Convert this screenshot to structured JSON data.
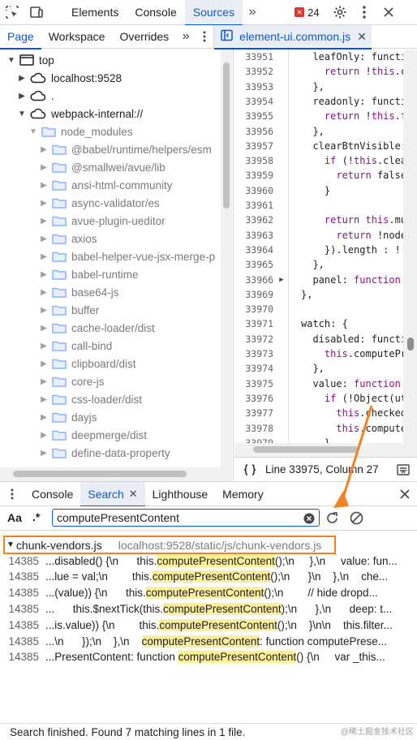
{
  "main_toolbar": {
    "tabs": [
      "Elements",
      "Console",
      "Sources"
    ],
    "active_tab": "Sources",
    "error_count": "24"
  },
  "sources_toolbar": {
    "tabs": [
      "Page",
      "Workspace",
      "Overrides"
    ],
    "active_tab": "Page",
    "open_file": "element-ui.common.js"
  },
  "navigator": {
    "items": [
      {
        "label": "top",
        "kind": "frame",
        "expanded": true
      },
      {
        "label": "localhost:9528",
        "kind": "cloud",
        "expanded": false
      },
      {
        "label": ".",
        "kind": "cloud",
        "expanded": false
      },
      {
        "label": "webpack-internal://",
        "kind": "cloud",
        "expanded": true
      },
      {
        "label": "node_modules",
        "kind": "folder",
        "expanded": true
      },
      {
        "label": "@babel/runtime/helpers/esm",
        "kind": "folder",
        "expanded": false
      },
      {
        "label": "@smallwei/avue/lib",
        "kind": "folder",
        "expanded": false
      },
      {
        "label": "ansi-html-community",
        "kind": "folder",
        "expanded": false
      },
      {
        "label": "async-validator/es",
        "kind": "folder",
        "expanded": false
      },
      {
        "label": "avue-plugin-ueditor",
        "kind": "folder",
        "expanded": false
      },
      {
        "label": "axios",
        "kind": "folder",
        "expanded": false
      },
      {
        "label": "babel-helper-vue-jsx-merge-p",
        "kind": "folder",
        "expanded": false
      },
      {
        "label": "babel-runtime",
        "kind": "folder",
        "expanded": false
      },
      {
        "label": "base64-js",
        "kind": "folder",
        "expanded": false
      },
      {
        "label": "buffer",
        "kind": "folder",
        "expanded": false
      },
      {
        "label": "cache-loader/dist",
        "kind": "folder",
        "expanded": false
      },
      {
        "label": "call-bind",
        "kind": "folder",
        "expanded": false
      },
      {
        "label": "clipboard/dist",
        "kind": "folder",
        "expanded": false
      },
      {
        "label": "core-js",
        "kind": "folder",
        "expanded": false
      },
      {
        "label": "css-loader/dist",
        "kind": "folder",
        "expanded": false
      },
      {
        "label": "dayjs",
        "kind": "folder",
        "expanded": false
      },
      {
        "label": "deepmerge/dist",
        "kind": "folder",
        "expanded": false
      },
      {
        "label": "define-data-property",
        "kind": "folder",
        "expanded": false
      }
    ]
  },
  "editor": {
    "lines": [
      {
        "n": "33951",
        "fold": "",
        "code": "  leafOnly: functi"
      },
      {
        "n": "33952",
        "fold": "",
        "code": "    return !this.c"
      },
      {
        "n": "33953",
        "fold": "",
        "code": "  },"
      },
      {
        "n": "33954",
        "fold": "",
        "code": "  readonly: functi"
      },
      {
        "n": "33955",
        "fold": "",
        "code": "    return !this.f"
      },
      {
        "n": "33956",
        "fold": "",
        "code": "  },"
      },
      {
        "n": "33957",
        "fold": "",
        "code": "  clearBtnVisible:"
      },
      {
        "n": "33958",
        "fold": "",
        "code": "    if (!this.clea"
      },
      {
        "n": "33959",
        "fold": "",
        "code": "      return false"
      },
      {
        "n": "33960",
        "fold": "",
        "code": "    }"
      },
      {
        "n": "33961",
        "fold": "",
        "code": ""
      },
      {
        "n": "33962",
        "fold": "",
        "code": "    return this.mu"
      },
      {
        "n": "33963",
        "fold": "",
        "code": "      return !node"
      },
      {
        "n": "33964",
        "fold": "",
        "code": "    }).length : !!"
      },
      {
        "n": "33965",
        "fold": "",
        "code": "  },"
      },
      {
        "n": "33966",
        "fold": "▶",
        "code": "  panel: function"
      },
      {
        "n": "33969",
        "fold": "",
        "code": "},"
      },
      {
        "n": "33970",
        "fold": "",
        "code": ""
      },
      {
        "n": "33971",
        "fold": "",
        "code": "watch: {"
      },
      {
        "n": "33972",
        "fold": "",
        "code": "  disabled: functi"
      },
      {
        "n": "33973",
        "fold": "",
        "code": "    this.computePr"
      },
      {
        "n": "33974",
        "fold": "",
        "code": "  },"
      },
      {
        "n": "33975",
        "fold": "",
        "code": "  value: function"
      },
      {
        "n": "33976",
        "fold": "",
        "code": "    if (!Object(ut"
      },
      {
        "n": "33977",
        "fold": "",
        "code": "      this.checked"
      },
      {
        "n": "33978",
        "fold": "",
        "code": "      this.compute"
      },
      {
        "n": "33979",
        "fold": "",
        "code": "    }"
      }
    ],
    "status": "Line 33975, Column 27"
  },
  "drawer": {
    "tabs": [
      "Console",
      "Search",
      "Lighthouse",
      "Memory"
    ],
    "active_tab": "Search"
  },
  "search": {
    "case_toggle": "Aa",
    "regex_toggle": ".*",
    "query": "computePresentContent",
    "result_file": "chunk-vendors.js",
    "result_path": "localhost:9528/static/js/chunk-vendors.js",
    "matches": [
      {
        "line": "14385",
        "before": "...disabled() {\\n      this.",
        "hit": "computePresentContent",
        "after": "();\\n     },\\n     value: fun..."
      },
      {
        "line": "14385",
        "before": "...lue = val;\\n        this.",
        "hit": "computePresentContent",
        "after": "();\\n      }\\n    },\\n    che..."
      },
      {
        "line": "14385",
        "before": "...(value)) {\\n      this.",
        "hit": "computePresentContent",
        "after": "();\\n        // hide dropd..."
      },
      {
        "line": "14385",
        "before": "...      this.$nextTick(this.",
        "hit": "computePresentContent",
        "after": ");\\n      },\\n      deep: t..."
      },
      {
        "line": "14385",
        "before": "...is.value)) {\\n        this.",
        "hit": "computePresentContent",
        "after": "();\\n    }\\n\\n    this.filter..."
      },
      {
        "line": "14385",
        "before": "...\\n      });\\n    },\\n    ",
        "hit": "computePresentContent",
        "after": ": function computePrese..."
      },
      {
        "line": "14385",
        "before": "...PresentContent: function ",
        "hit": "computePresentContent",
        "after": "() {\\n     var _this..."
      }
    ],
    "status": "Search finished.  Found 7 matching lines in 1 file."
  },
  "watermark": "@稀土掘金技术社区",
  "colors": {
    "accent": "#0b57d0",
    "highlight": "#fcef9c",
    "annotation": "#f58220",
    "error": "#dc362e"
  }
}
